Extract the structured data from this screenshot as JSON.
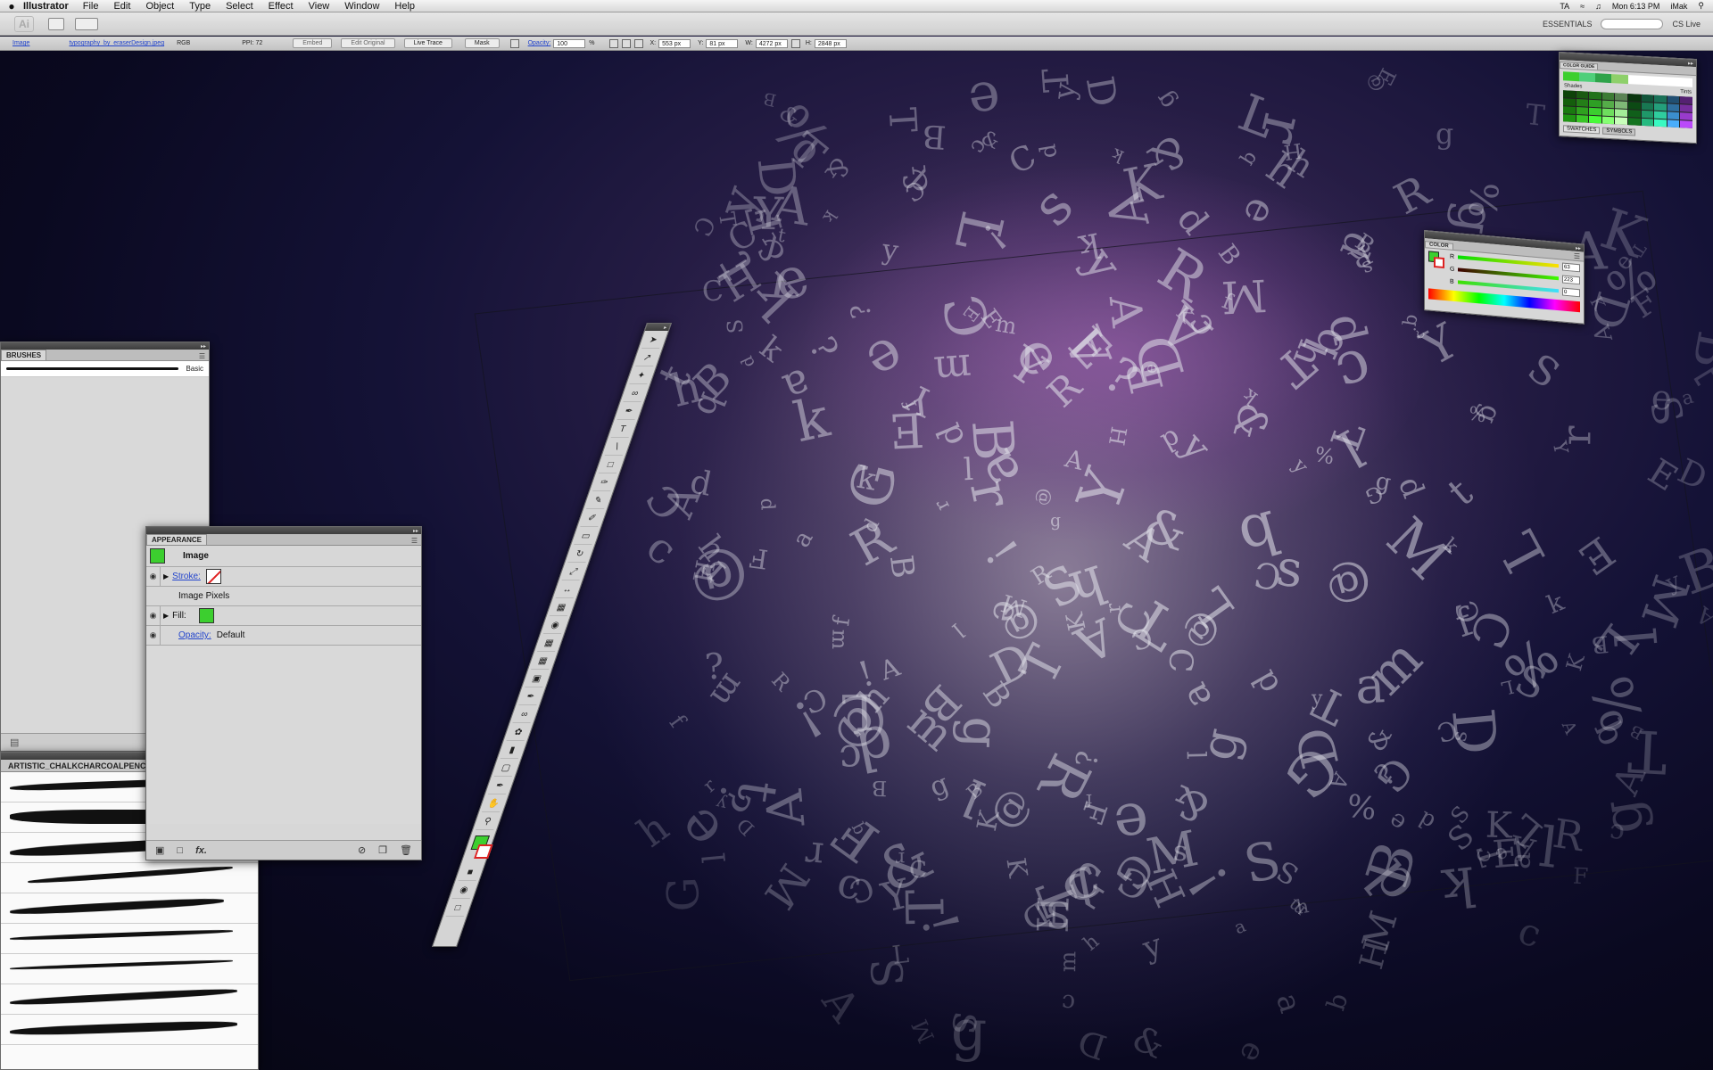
{
  "menubar": {
    "apple": "",
    "app_name": "Illustrator",
    "items": [
      "File",
      "Edit",
      "Object",
      "Type",
      "Select",
      "Effect",
      "View",
      "Window",
      "Help"
    ],
    "status": {
      "language": "TA",
      "clock": "Mon 6:13 PM",
      "user": "iMak"
    }
  },
  "appbar": {
    "logo": "Ai",
    "workspace": "ESSENTIALS",
    "cslive": "CS Live"
  },
  "controlbar": {
    "selection_type": "Image",
    "file_link": "typography_by_eraserDesign.jpeg",
    "color_mode": "RGB",
    "ppi": "PPI: 72",
    "embed": "Embed",
    "edit_original": "Edit Original",
    "live_trace": "Live Trace",
    "mask": "Mask",
    "opacity_label": "Opacity:",
    "opacity_value": "100",
    "percent": "%",
    "x_label": "X:",
    "x_value": "553 px",
    "y_label": "Y:",
    "y_value": "81 px",
    "w_label": "W:",
    "w_value": "4272 px",
    "h_label": "H:",
    "h_value": "2848 px"
  },
  "brushes_panel": {
    "tab": "BRUSHES",
    "brush_name": "Basic"
  },
  "charcoal_panel": {
    "title": "ARTISTIC_CHALKCHARCOALPENCIL"
  },
  "appearance_panel": {
    "tab": "APPEARANCE",
    "object": "Image",
    "stroke_label": "Stroke:",
    "section": "Image Pixels",
    "fill_label": "Fill:",
    "opacity_label": "Opacity:",
    "opacity_value": "Default",
    "fx": "fx."
  },
  "color_panel": {
    "tab": "COLOR",
    "r_label": "R",
    "r_value": "63",
    "g_label": "G",
    "g_value": "223",
    "b_label": "B",
    "b_value": "0"
  },
  "color_guide": {
    "tab": "COLOR GUIDE",
    "shades": "Shades",
    "tints": "Tints",
    "swatches_tab": "SWATCHES",
    "symbols_tab": "SYMBOLS"
  },
  "colors": {
    "fill_green": "#3ccf2f",
    "link_blue": "#2244cc"
  }
}
